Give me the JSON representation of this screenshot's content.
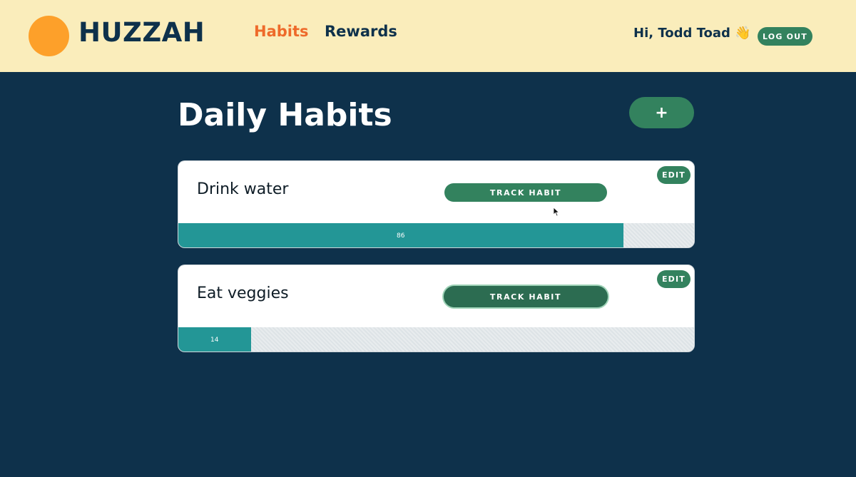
{
  "header": {
    "logo_text": "HUZZAH",
    "nav": [
      {
        "label": "Habits",
        "active": true
      },
      {
        "label": "Rewards",
        "active": false
      }
    ],
    "greeting": "Hi, Todd Toad 👋",
    "logout_label": "LOG OUT"
  },
  "main": {
    "title": "Daily Habits",
    "add_label": "+"
  },
  "habits": [
    {
      "name": "Drink water",
      "track_label": "TRACK HABIT",
      "edit_label": "EDIT",
      "progress": 86,
      "progress_label": "86"
    },
    {
      "name": "Eat veggies",
      "track_label": "TRACK HABIT",
      "edit_label": "EDIT",
      "progress": 14,
      "progress_label": "14"
    }
  ],
  "colors": {
    "background": "#0e314b",
    "header_bg": "#faedbb",
    "logo": "#fda02a",
    "accent_orange": "#ee6a2a",
    "button_green": "#33825e",
    "progress_teal": "#239696"
  }
}
